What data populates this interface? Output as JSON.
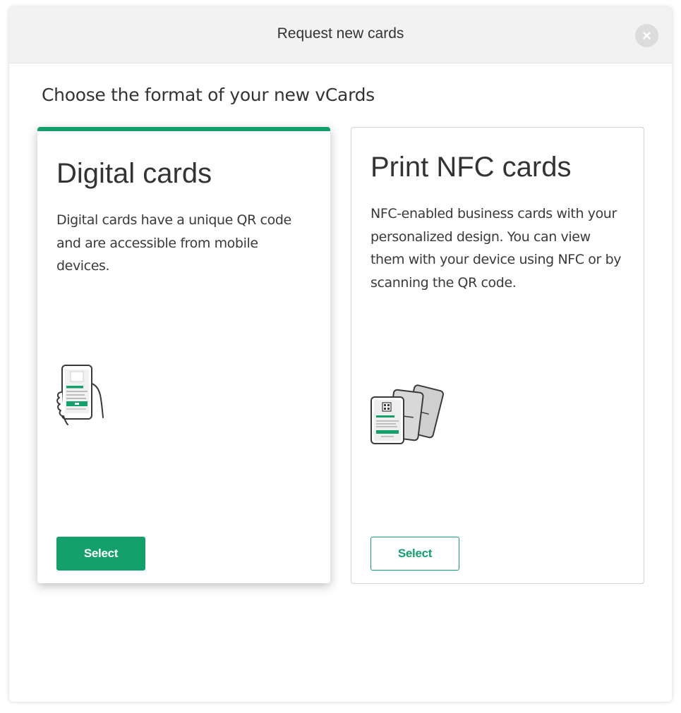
{
  "modal": {
    "title": "Request new cards",
    "close_icon": "close-icon"
  },
  "subtitle": "Choose the format of your new vCards",
  "colors": {
    "accent": "#13a06b",
    "header_bg": "#f2f2f2",
    "text": "#333333"
  },
  "cards": [
    {
      "title": "Digital cards",
      "description": "Digital cards have a unique QR code and are accessible from mobile devices.",
      "icon": "phone-in-hand-icon",
      "button_label": "Select",
      "selected": true
    },
    {
      "title": "Print NFC cards",
      "description": "NFC-enabled business cards with your personalized design. You can view them with your device using NFC or by scanning the QR code.",
      "icon": "nfc-cards-stack-icon",
      "button_label": "Select",
      "selected": false
    }
  ]
}
